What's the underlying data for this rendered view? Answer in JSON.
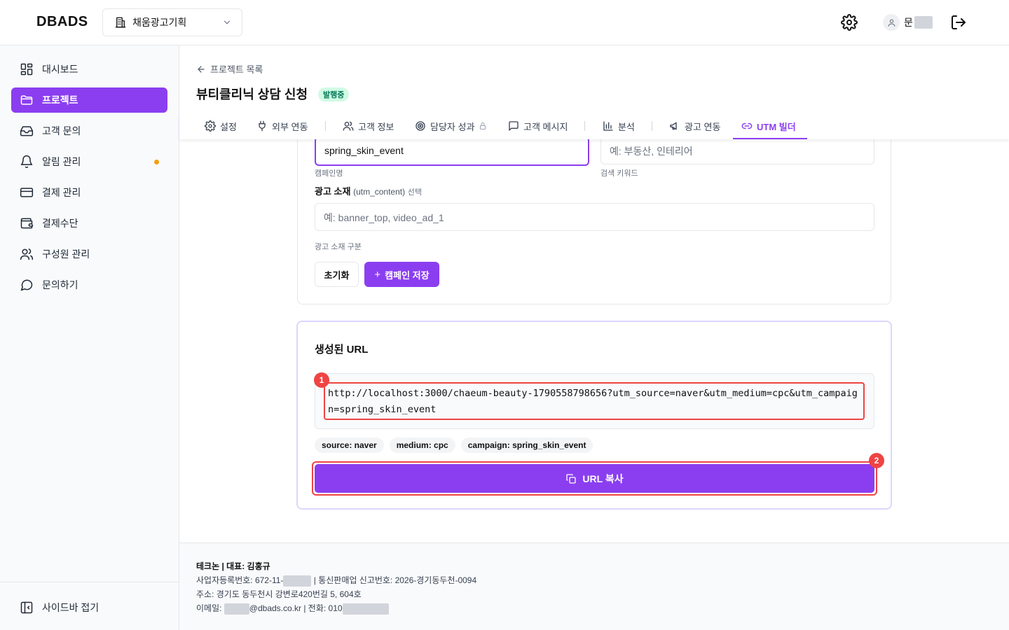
{
  "header": {
    "logo": "DBADS",
    "org_name": "채움광고기획",
    "user_name_prefix": "문"
  },
  "sidebar": {
    "items": [
      {
        "label": "대시보드",
        "icon": "dashboard-icon"
      },
      {
        "label": "프로젝트",
        "icon": "folder-icon",
        "active": true
      },
      {
        "label": "고객 문의",
        "icon": "inbox-icon"
      },
      {
        "label": "알림 관리",
        "icon": "bell-icon",
        "badge": "dot"
      },
      {
        "label": "결제 관리",
        "icon": "credit-card-icon"
      },
      {
        "label": "결제수단",
        "icon": "wallet-icon"
      },
      {
        "label": "구성원 관리",
        "icon": "users-icon"
      },
      {
        "label": "문의하기",
        "icon": "chat-bubble-icon"
      }
    ],
    "collapse_label": "사이드바 접기"
  },
  "main": {
    "back_label": "프로젝트 목록",
    "title": "뷰티클리닉 상담 신청",
    "status": "발행중",
    "tabs": [
      {
        "label": "설정",
        "icon": "gear-icon"
      },
      {
        "label": "외부 연동",
        "icon": "plug-icon"
      },
      {
        "label": "고객 정보",
        "icon": "users-icon"
      },
      {
        "label": "담당자 성과",
        "icon": "target-icon",
        "locked": true
      },
      {
        "label": "고객 메시지",
        "icon": "message-icon"
      },
      {
        "label": "분석",
        "icon": "bar-chart-icon"
      },
      {
        "label": "광고 연동",
        "icon": "megaphone-icon"
      },
      {
        "label": "UTM 빌더",
        "icon": "link-icon",
        "active": true
      }
    ]
  },
  "form": {
    "campaign_value": "spring_skin_event",
    "campaign_help": "캠페인명",
    "term_placeholder": "예: 부동산, 인테리어",
    "term_help": "검색 키워드",
    "content_label": "광고 소재",
    "content_param": "(utm_content)",
    "content_optional": "선택",
    "content_placeholder": "예: banner_top, video_ad_1",
    "content_help": "광고 소재 구분",
    "reset_label": "초기화",
    "save_label": "캠페인 저장"
  },
  "generated": {
    "title": "생성된 URL",
    "url": "http://localhost:3000/chaeum-beauty-1790558798656?utm_source=naver&utm_medium=cpc&utm_campaign=spring_skin_event",
    "chips": [
      "source: naver",
      "medium: cpc",
      "campaign: spring_skin_event"
    ],
    "copy_label": "URL 복사",
    "markers": [
      "1",
      "2"
    ]
  },
  "footer": {
    "company": "테크논 | 대표: 김홍규",
    "biz_prefix": "사업자등록번호: 672-11-",
    "biz_suffix": " | 통신판매업 신고번호: 2026-경기동두천-0094",
    "address": "주소: 경기도 동두천시 강변로420번길 5, 604호",
    "email_prefix": "이메일: ",
    "email_suffix": "@dbads.co.kr | 전화: 010"
  },
  "colors": {
    "accent": "#8b3ef0",
    "annotation": "#ef4444",
    "status_bg": "#d1fae5",
    "status_fg": "#047857"
  }
}
